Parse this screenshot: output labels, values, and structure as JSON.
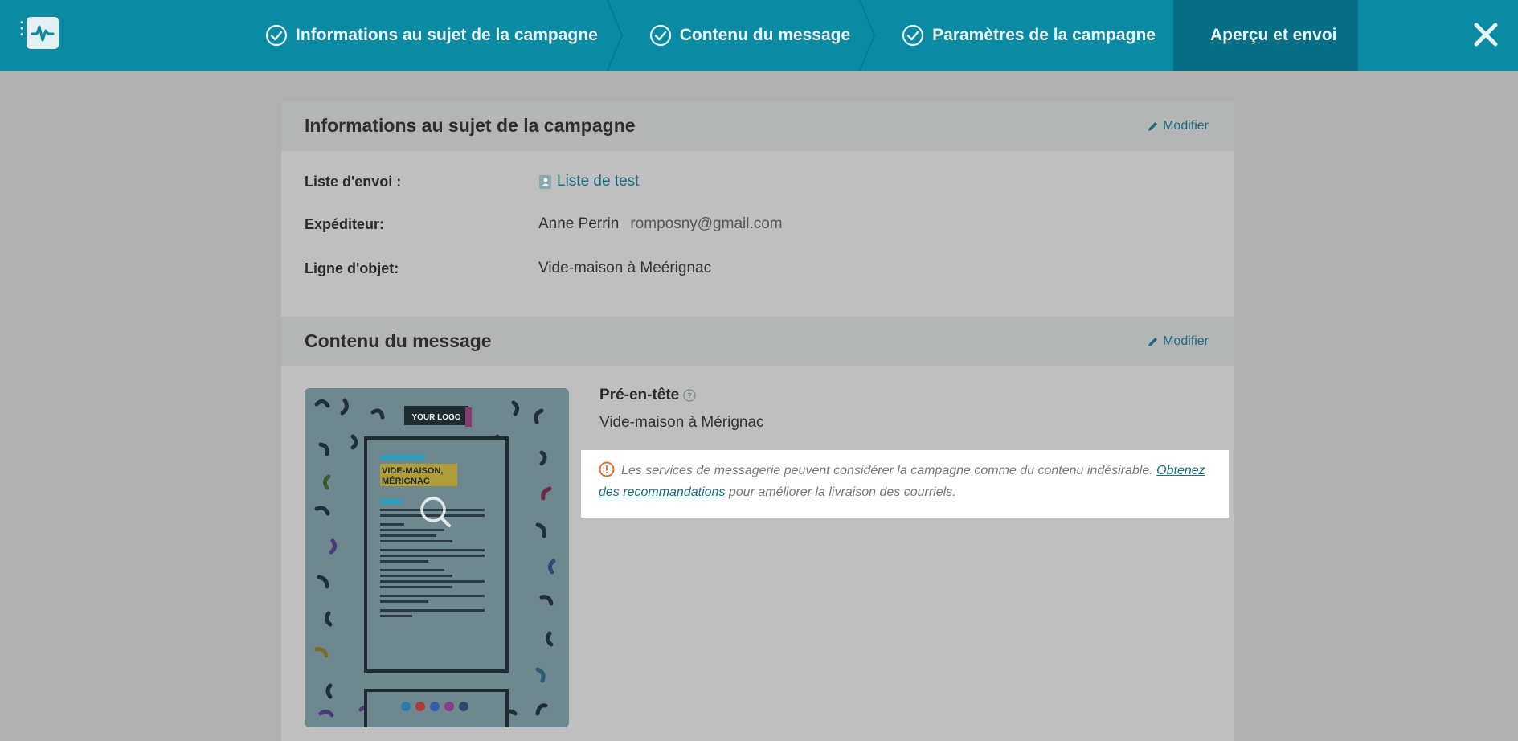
{
  "topbar": {
    "steps": [
      {
        "label": "Informations au sujet de la campagne",
        "done": true
      },
      {
        "label": "Contenu du message",
        "done": true
      },
      {
        "label": "Paramètres de la campagne",
        "done": true
      },
      {
        "label": "Aperçu et envoi",
        "done": false,
        "active": true
      }
    ]
  },
  "info_section": {
    "title": "Informations au sujet de la campagne",
    "modify_label": "Modifier",
    "rows": {
      "list_label": "Liste d'envoi :",
      "list_value": "Liste de test",
      "sender_label": "Expéditeur:",
      "sender_name": "Anne Perrin",
      "sender_email": "romposny@gmail.com",
      "subject_label": "Ligne d'objet:",
      "subject_value": "Vide-maison à Meérignac"
    }
  },
  "content_section": {
    "title": "Contenu du message",
    "modify_label": "Modifier",
    "thumbnail": {
      "logo_text": "YOUR LOGO",
      "heading": "VIDE-MAISON, MÉRIGNAC"
    },
    "preheader_label": "Pré-en-tête",
    "preheader_value": "Vide-maison à Mérignac",
    "warning": {
      "text_before": "Les services de messagerie peuvent considérer la campagne comme du contenu indésirable. ",
      "link_text": "Obtenez des recommandations",
      "text_after": " pour améliorer la livraison des courriels."
    }
  },
  "colors": {
    "topbar": "#0a8aa3",
    "active_step": "#066f86",
    "link": "#1c6b80",
    "warning_icon": "#e2703a"
  }
}
